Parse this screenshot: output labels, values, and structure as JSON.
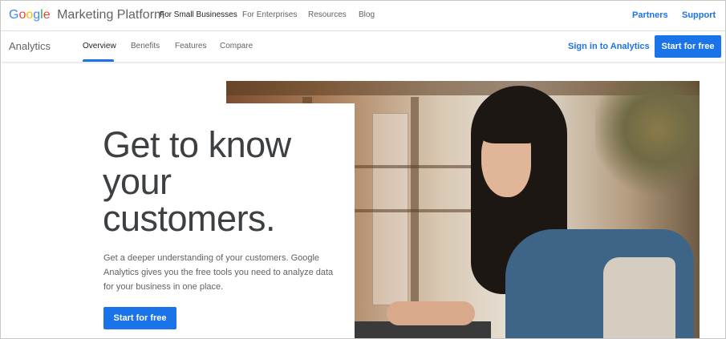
{
  "topbar": {
    "brand_letters": [
      "G",
      "o",
      "o",
      "g",
      "l",
      "e"
    ],
    "brand_platform": "Marketing Platform",
    "nav": [
      "For Small Businesses",
      "For Enterprises",
      "Resources",
      "Blog"
    ],
    "right_links": [
      "Partners",
      "Support"
    ]
  },
  "subbar": {
    "product": "Analytics",
    "tabs": [
      "Overview",
      "Benefits",
      "Features",
      "Compare"
    ],
    "active_tab": "Overview",
    "signin": "Sign in to Analytics",
    "start": "Start for free"
  },
  "hero": {
    "headline_lines": [
      "Get to know",
      "your",
      "customers."
    ],
    "subtext": "Get a deeper understanding of your customers. Google Analytics gives you the free tools you need to analyze data for your business in one place.",
    "cta": "Start for free"
  },
  "colors": {
    "accent": "#1a73e8",
    "google_blue": "#4285f4",
    "google_red": "#ea4335",
    "google_yellow": "#fbbc05",
    "google_green": "#34a853"
  }
}
